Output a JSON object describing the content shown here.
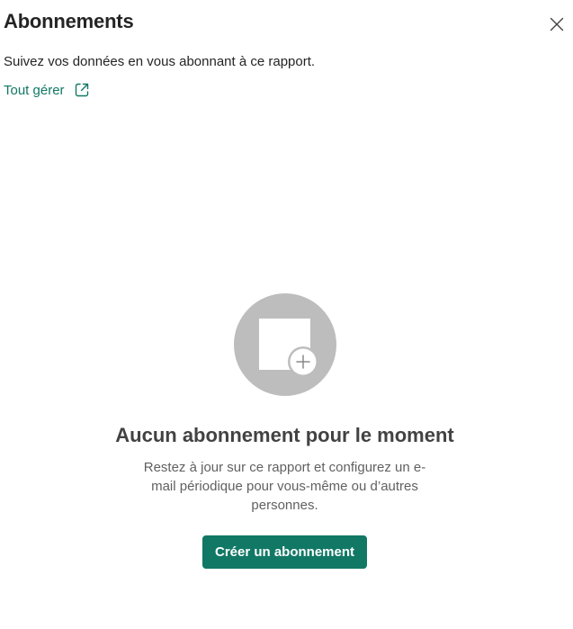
{
  "panel": {
    "title": "Abonnements",
    "close_icon": "close-icon",
    "subtitle": "Suivez vos données en vous abonnant à ce rapport.",
    "manage_link": {
      "label": "Tout gérer",
      "icon": "open-external-icon"
    }
  },
  "empty_state": {
    "illustration_icon": "add-subscription-illustration",
    "title": "Aucun abonnement pour le moment",
    "description": "Restez à jour sur ce rapport et configurez un e-mail périodique pour vous-même ou d’autres personnes.",
    "cta_label": "Créer un abonnement"
  },
  "colors": {
    "accent": "#117865",
    "illustration_gray": "#bdbdbd",
    "title_text": "#242424",
    "secondary_text": "#616161"
  }
}
